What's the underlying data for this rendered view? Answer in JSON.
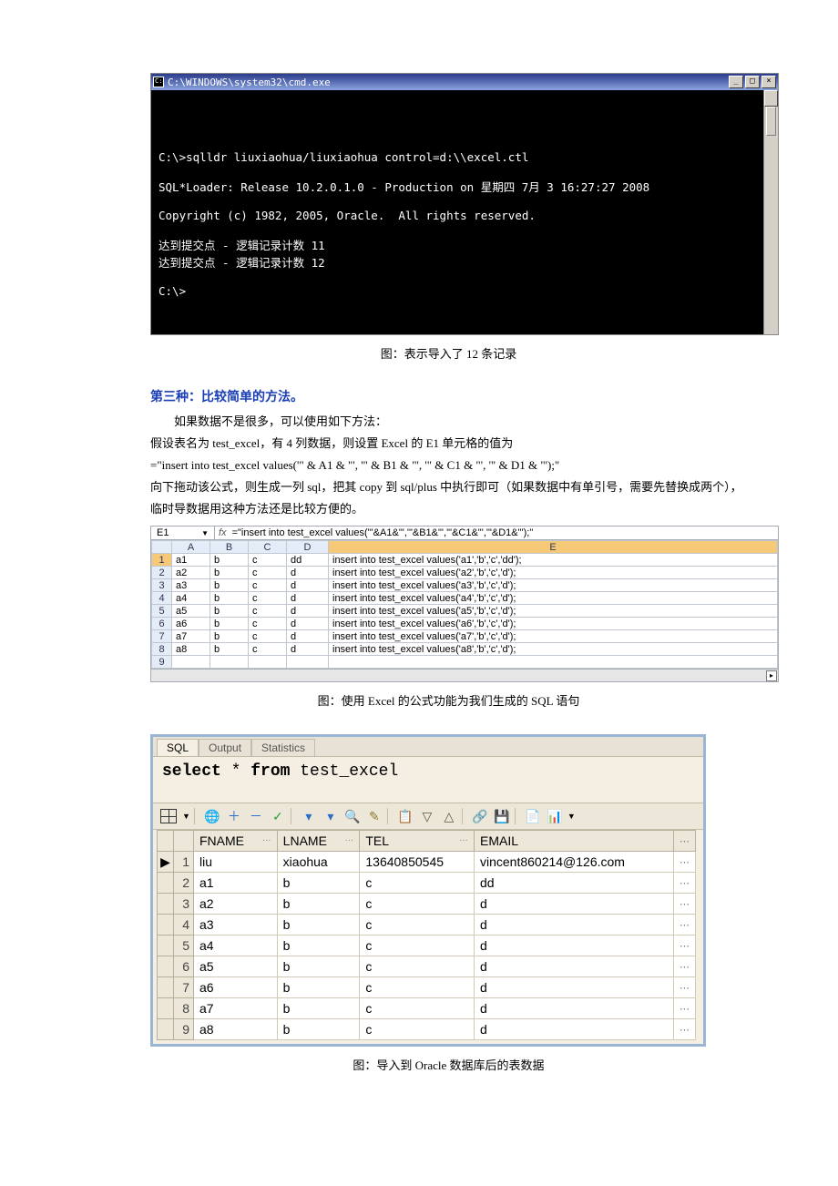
{
  "cmd": {
    "title": "C:\\WINDOWS\\system32\\cmd.exe",
    "btn_min": "_",
    "btn_max": "□",
    "btn_close": "×",
    "lines": [
      "",
      "C:\\>sqlldr liuxiaohua/liuxiaohua control=d:\\\\excel.ctl",
      "",
      "SQL*Loader: Release 10.2.0.1.0 - Production on 星期四 7月 3 16:27:27 2008",
      "",
      "Copyright (c) 1982, 2005, Oracle.  All rights reserved.",
      "",
      "达到提交点 - 逻辑记录计数 11",
      "达到提交点 - 逻辑记录计数 12",
      "",
      "C:\\>"
    ]
  },
  "caption1": "图：表示导入了 12 条记录",
  "heading3": "第三种：比较简单的方法。",
  "para1": "如果数据不是很多，可以使用如下方法：",
  "para2": "假设表名为 test_excel，有 4 列数据，则设置 Excel 的 E1 单元格的值为",
  "para3": "=\"insert into test_excel values('\" & A1 & \"', '\" & B1 & \"', '\" & C1 & \"', '\" & D1 & \"');\"",
  "para4": "向下拖动该公式，则生成一列 sql，把其 copy 到 sql/plus 中执行即可（如果数据中有单引号，需要先替换成两个），临时导数据用这种方法还是比较方便的。",
  "excel": {
    "namebox": "E1",
    "formula": "=\"insert into test_excel values('\"&A1&\"','\"&B1&\"','\"&C1&\"','\"&D1&\"');\"",
    "headers": [
      "",
      "A",
      "B",
      "C",
      "D",
      "E"
    ],
    "rows": [
      {
        "n": "1",
        "a": "a1",
        "b": "b",
        "c": "c",
        "d": "dd",
        "e": "insert into test_excel values('a1','b','c','dd');"
      },
      {
        "n": "2",
        "a": "a2",
        "b": "b",
        "c": "c",
        "d": "d",
        "e": "insert into test_excel values('a2','b','c','d');"
      },
      {
        "n": "3",
        "a": "a3",
        "b": "b",
        "c": "c",
        "d": "d",
        "e": "insert into test_excel values('a3','b','c','d');"
      },
      {
        "n": "4",
        "a": "a4",
        "b": "b",
        "c": "c",
        "d": "d",
        "e": "insert into test_excel values('a4','b','c','d');"
      },
      {
        "n": "5",
        "a": "a5",
        "b": "b",
        "c": "c",
        "d": "d",
        "e": "insert into test_excel values('a5','b','c','d');"
      },
      {
        "n": "6",
        "a": "a6",
        "b": "b",
        "c": "c",
        "d": "d",
        "e": "insert into test_excel values('a6','b','c','d');"
      },
      {
        "n": "7",
        "a": "a7",
        "b": "b",
        "c": "c",
        "d": "d",
        "e": "insert into test_excel values('a7','b','c','d');"
      },
      {
        "n": "8",
        "a": "a8",
        "b": "b",
        "c": "c",
        "d": "d",
        "e": "insert into test_excel values('a8','b','c','d');"
      }
    ],
    "blankrow": "9"
  },
  "caption2": "图：使用 Excel 的公式功能为我们生成的 SQL 语句",
  "sqltool": {
    "tabs": {
      "sql": "SQL",
      "output": "Output",
      "stats": "Statistics"
    },
    "query_kw1": "select",
    "query_mid": " * ",
    "query_kw2": "from",
    "query_tail": " test_excel",
    "toolbar_icons": {
      "grid": "grid-icon",
      "globe": "🌐",
      "plus": "＋",
      "minus": "－",
      "check": "✓",
      "filter1": "▾",
      "filter2": "▾",
      "binoc": "🔍",
      "pencil": "✎",
      "copy": "📋",
      "down": "▽",
      "up": "△",
      "link": "🔗",
      "save": "💾",
      "doc": "📄",
      "chart": "📊"
    },
    "cols": {
      "fname": "FNAME",
      "lname": "LNAME",
      "tel": "TEL",
      "email": "EMAIL"
    },
    "current_marker": "▶",
    "rows": [
      {
        "i": "1",
        "fname": "liu",
        "lname": "xiaohua",
        "tel": "13640850545",
        "email": "vincent860214@126.com"
      },
      {
        "i": "2",
        "fname": "a1",
        "lname": "b",
        "tel": "c",
        "email": "dd"
      },
      {
        "i": "3",
        "fname": "a2",
        "lname": "b",
        "tel": "c",
        "email": "d"
      },
      {
        "i": "4",
        "fname": "a3",
        "lname": "b",
        "tel": "c",
        "email": "d"
      },
      {
        "i": "5",
        "fname": "a4",
        "lname": "b",
        "tel": "c",
        "email": "d"
      },
      {
        "i": "6",
        "fname": "a5",
        "lname": "b",
        "tel": "c",
        "email": "d"
      },
      {
        "i": "7",
        "fname": "a6",
        "lname": "b",
        "tel": "c",
        "email": "d"
      },
      {
        "i": "8",
        "fname": "a7",
        "lname": "b",
        "tel": "c",
        "email": "d"
      },
      {
        "i": "9",
        "fname": "a8",
        "lname": "b",
        "tel": "c",
        "email": "d"
      }
    ]
  },
  "caption3": "图：导入到 Oracle 数据库后的表数据"
}
